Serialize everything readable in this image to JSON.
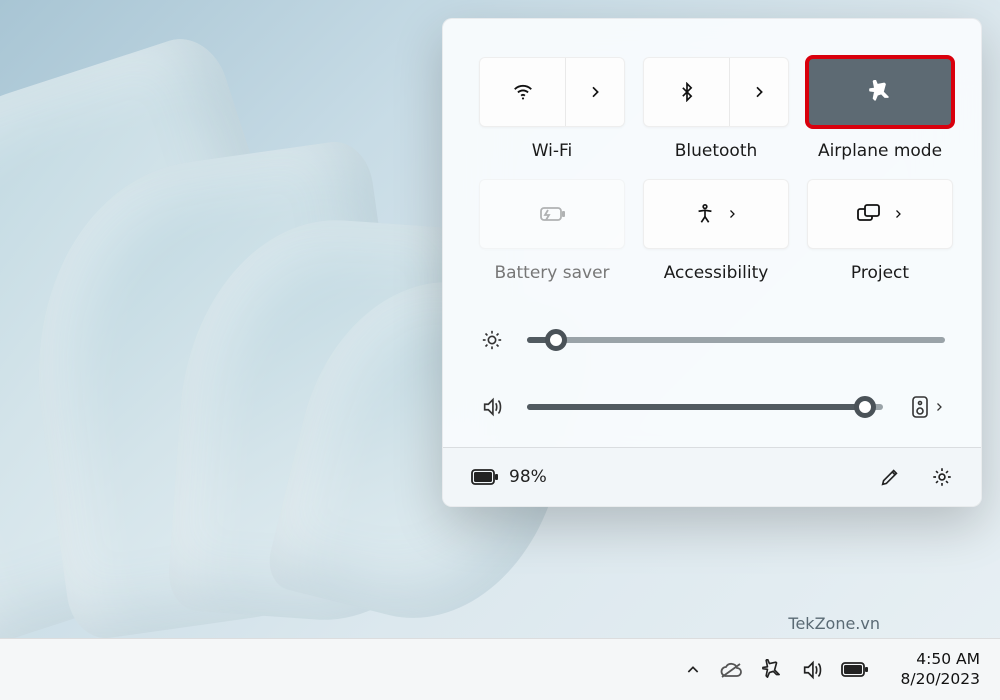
{
  "quick_settings": {
    "tiles": {
      "wifi": {
        "label": "Wi-Fi",
        "active": false,
        "has_submenu": true,
        "disabled": false
      },
      "bluetooth": {
        "label": "Bluetooth",
        "active": false,
        "has_submenu": true,
        "disabled": false
      },
      "airplane_mode": {
        "label": "Airplane mode",
        "active": true,
        "has_submenu": false,
        "disabled": false,
        "highlighted": true
      },
      "battery_saver": {
        "label": "Battery saver",
        "active": false,
        "has_submenu": false,
        "disabled": true
      },
      "accessibility": {
        "label": "Accessibility",
        "active": false,
        "has_submenu": true,
        "disabled": false
      },
      "project": {
        "label": "Project",
        "active": false,
        "has_submenu": true,
        "disabled": false
      }
    },
    "sliders": {
      "brightness": {
        "percent": 7
      },
      "volume": {
        "percent": 95
      }
    },
    "footer": {
      "battery_percent_label": "98%"
    }
  },
  "watermark": "TekZone.vn",
  "taskbar": {
    "time": "4:50 AM",
    "date": "8/20/2023"
  }
}
